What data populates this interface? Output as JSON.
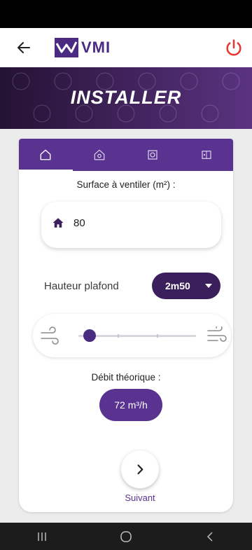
{
  "app": {
    "logo_text": "VMI",
    "banner_title": "INSTALLER",
    "accent_color": "#5a3290",
    "dark_accent_color": "#3a1f5c"
  },
  "header": {
    "back_icon": "arrow-left-icon",
    "power_icon": "power-icon",
    "power_color": "#e53935"
  },
  "tabs": [
    {
      "icon": "home-outline-icon",
      "active": true
    },
    {
      "icon": "house-gear-icon",
      "active": false
    },
    {
      "icon": "ventilation-unit-icon",
      "active": false
    },
    {
      "icon": "control-panel-icon",
      "active": false
    }
  ],
  "surface": {
    "label": "Surface à ventiler (m²) :",
    "value": "80",
    "icon": "home-icon"
  },
  "hauteur": {
    "label": "Hauteur plafond",
    "selected": "2m50"
  },
  "airflow_slider": {
    "left_icon": "wind-low-icon",
    "right_icon": "wind-high-icon",
    "level": 0.05
  },
  "debit": {
    "label": "Débit théorique :",
    "value": "72 m³/h"
  },
  "next": {
    "label": "Suivant",
    "icon": "chevron-right-icon"
  },
  "nav": {
    "recents_icon": "recents-icon",
    "home_icon": "home-circle-icon",
    "back_icon": "nav-back-icon"
  }
}
